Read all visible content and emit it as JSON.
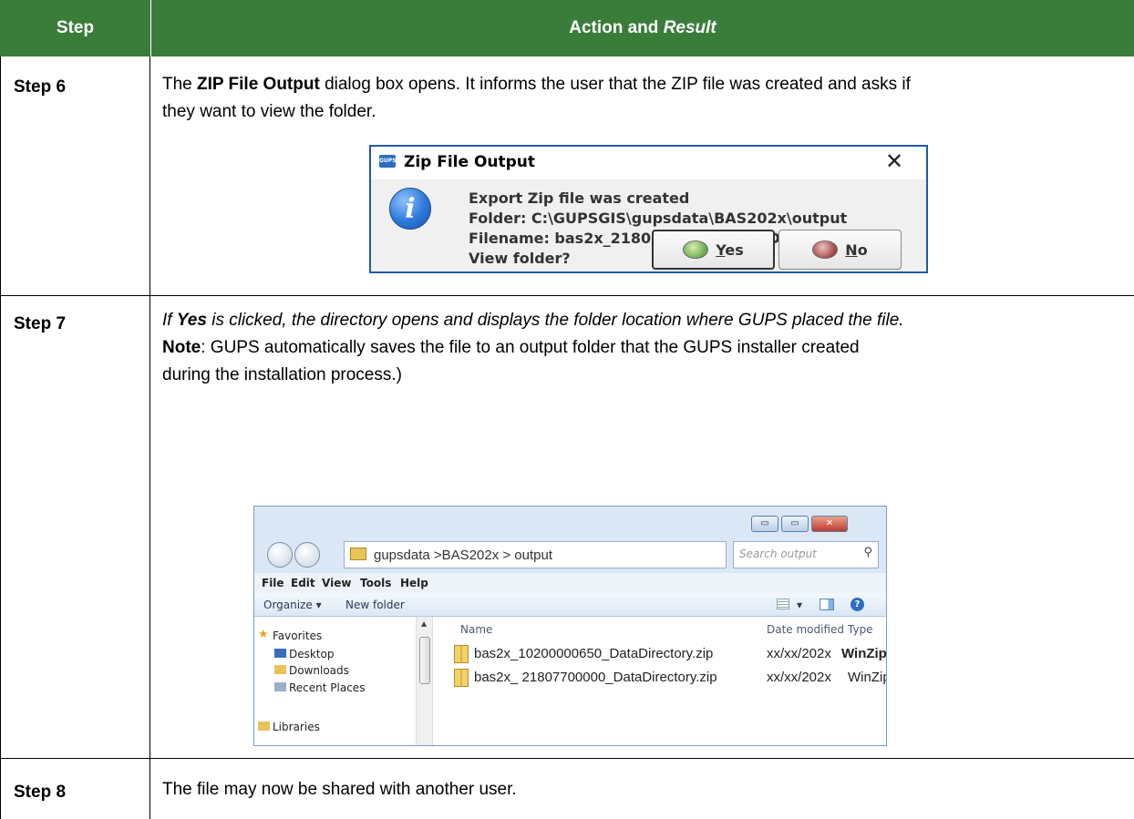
{
  "header": {
    "step_col": "Step",
    "action_col_prefix": "Action and ",
    "action_col_italic": "Result"
  },
  "rows": [
    {
      "step": "Step 6",
      "text_a": "The ",
      "text_b": "ZIP File Output",
      "text_c": " dialog box opens. It informs the user that the ZIP file was created and asks if",
      "text_d": "they want to view the folder."
    },
    {
      "step": "Step 7",
      "line1_a": "If ",
      "line1_b": "Yes",
      "line1_c": " is clicked, the directory opens and displays the folder location where GUPS placed the file.",
      "note_label": "Note",
      "note_text": ":  GUPS automatically saves the file to an output folder that the GUPS installer created",
      "line3": "during the installation process.)"
    },
    {
      "step": "Step 8",
      "text": "The file may now be shared with another user."
    }
  ],
  "dialog": {
    "app_icon_text": "GUPS",
    "title": "Zip File Output",
    "close": "✕",
    "info_glyph": "i",
    "line1": "Export Zip file was created",
    "line2": "Folder: C:\\GUPSGIS\\gupsdata\\BAS202x\\output",
    "line3": "Filename: bas2x_21807700000_DataDirectory.zip",
    "line4": "View folder?",
    "yes_first": "Y",
    "yes_rest": "es",
    "no_first": "N",
    "no_rest": "o"
  },
  "explorer": {
    "win_min": "▭",
    "win_max": "▭",
    "win_close": "✕",
    "address": "gupsdata >BAS202x > output",
    "address_drop": "▾",
    "refresh": "↚",
    "search_placeholder": "Search output",
    "search_glyph": "⚲",
    "menu": [
      "File",
      "Edit",
      "View",
      "Tools",
      "Help"
    ],
    "organize": "Organize ▾",
    "new_folder": "New folder",
    "view_drop": "▾",
    "help_glyph": "?",
    "nav": [
      "Favorites",
      "Desktop",
      "Downloads",
      "Recent Places",
      "Libraries"
    ],
    "scroll_up": "▲",
    "columns": [
      "Name",
      "Date modified",
      "Type"
    ],
    "files": [
      {
        "name": "bas2x_10200000650_DataDirectory.zip",
        "date": "xx/xx/202x",
        "type": "WinZip File"
      },
      {
        "name": "bas2x_ 21807700000_DataDirectory.zip",
        "date": "xx/xx/202x",
        "type": "WinZip File"
      }
    ]
  },
  "colors": {
    "header_bg": "#3a7d3a",
    "dialog_border": "#1e5aa8"
  }
}
